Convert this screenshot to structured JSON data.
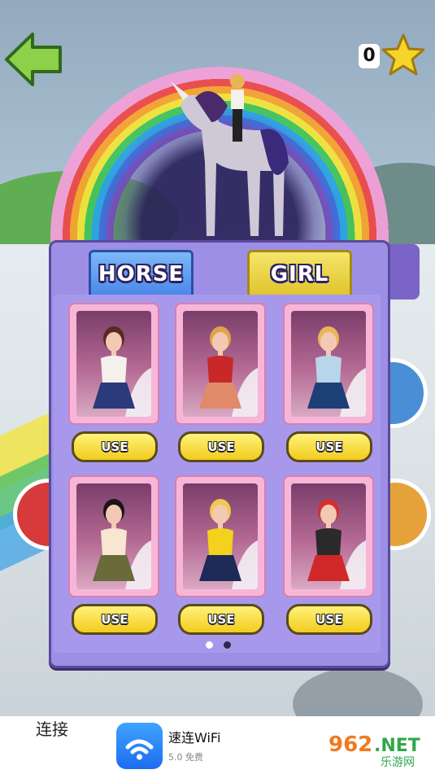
{
  "hud": {
    "coins": "0"
  },
  "tabs": [
    {
      "label": "HORSE",
      "active": true
    },
    {
      "label": "GIRL",
      "active": false
    }
  ],
  "cards": [
    {
      "use_label": "USE",
      "hair": "#5a2a22",
      "top": "#f4f0ec",
      "pants": "#2a3a7a"
    },
    {
      "use_label": "USE",
      "hair": "#e0a34a",
      "top": "#c8282a",
      "pants": "#e08a6a"
    },
    {
      "use_label": "USE",
      "hair": "#e8b558",
      "top": "#b8d6ea",
      "pants": "#1d3f78"
    },
    {
      "use_label": "USE",
      "hair": "#1c1418",
      "top": "#f6e6d2",
      "pants": "#6a6a3a"
    },
    {
      "use_label": "USE",
      "hair": "#f0c84a",
      "top": "#f2d21c",
      "pants": "#1e2a58"
    },
    {
      "use_label": "USE",
      "hair": "#d43030",
      "top": "#2a2a2a",
      "pants": "#d02828"
    }
  ],
  "pagination": {
    "pages": 2,
    "current": 1,
    "active_color": "#ffffff",
    "inactive_color": "#2a2a4a"
  },
  "ad": {
    "left_text": "连接",
    "app_name": "速连WiFi",
    "rating": "5.0 免费"
  },
  "watermark": {
    "text1": "962",
    "text2": ".NET",
    "text3": "乐游网"
  },
  "colors": {
    "panel": "#9d8fe6",
    "tab_horse": "#4a86e8",
    "tab_girl": "#e0c22c",
    "use_button": "#f2cc1e",
    "card_frame": "#f7b6d8"
  }
}
